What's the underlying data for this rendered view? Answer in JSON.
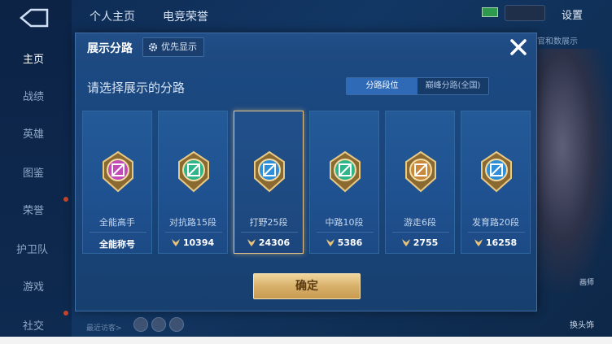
{
  "background": {
    "top_tabs": [
      "个人主页",
      "电竞荣誉"
    ],
    "settings": "设置",
    "top_right_text": "官和数展示",
    "sidebar": [
      "主页",
      "战绩",
      "英雄",
      "图鉴",
      "荣誉",
      "护卫队",
      "游戏",
      "社交"
    ],
    "recent_visitors": "最近访客>",
    "side_btn_label": "换头饰",
    "side_btn_label2": "画师"
  },
  "dialog": {
    "title": "展示分路",
    "priority_button": "优先显示",
    "subtitle": "请选择展示的分路",
    "toggle": {
      "options": [
        "分路段位",
        "巅峰分路(全国)"
      ],
      "selected": "分路段位"
    },
    "cards": [
      {
        "name": "全能高手",
        "score": "全能称号",
        "icon": "all-rounder-emblem-icon",
        "color": "#c24bb8",
        "selected": false
      },
      {
        "name": "对抗路15段",
        "score": "10394",
        "icon": "clash-lane-emblem-icon",
        "color": "#2fb58a",
        "selected": false
      },
      {
        "name": "打野25段",
        "score": "24306",
        "icon": "jungle-emblem-icon",
        "color": "#2e8fd8",
        "selected": true
      },
      {
        "name": "中路10段",
        "score": "5386",
        "icon": "mid-lane-emblem-icon",
        "color": "#2fb58a",
        "selected": false
      },
      {
        "name": "游走6段",
        "score": "2755",
        "icon": "roam-emblem-icon",
        "color": "#c88a3a",
        "selected": false
      },
      {
        "name": "发育路20段",
        "score": "16258",
        "icon": "farm-lane-emblem-icon",
        "color": "#2e8fd8",
        "selected": false
      }
    ],
    "confirm_button": "确定"
  }
}
